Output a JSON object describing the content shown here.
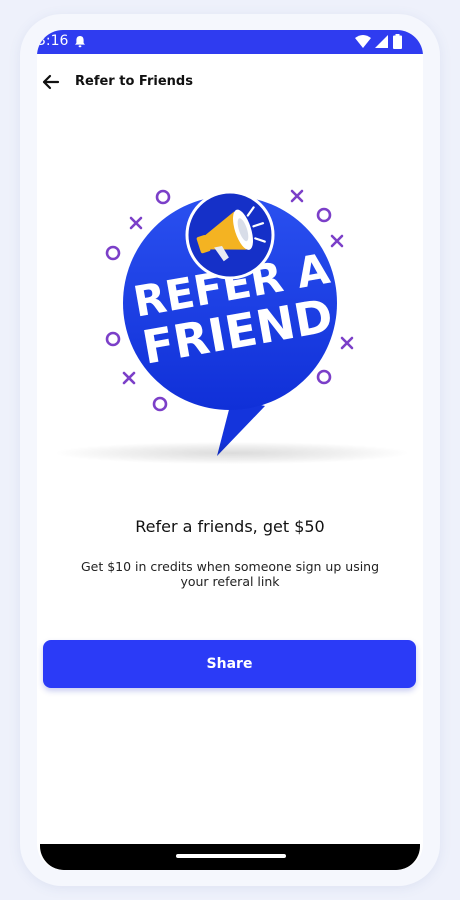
{
  "status_bar": {
    "time": "3:16",
    "bg_color": "#2f3cf0",
    "icons": [
      "bell-icon",
      "wifi-icon",
      "cell-signal-icon",
      "battery-icon"
    ]
  },
  "header": {
    "back_icon": "back-arrow-icon",
    "title": "Refer to Friends"
  },
  "illustration": {
    "badge_line1": "REFER A",
    "badge_line2": "FRIEND",
    "icon": "megaphone-icon",
    "bubble_color": "#1b3de8",
    "accent_color": "#7b3fc8"
  },
  "content": {
    "headline": "Refer a friends, get $50",
    "description": "Get $10 in credits when someone sign up using your referal link"
  },
  "actions": {
    "share_label": "Share",
    "share_color": "#2b3bf7"
  }
}
